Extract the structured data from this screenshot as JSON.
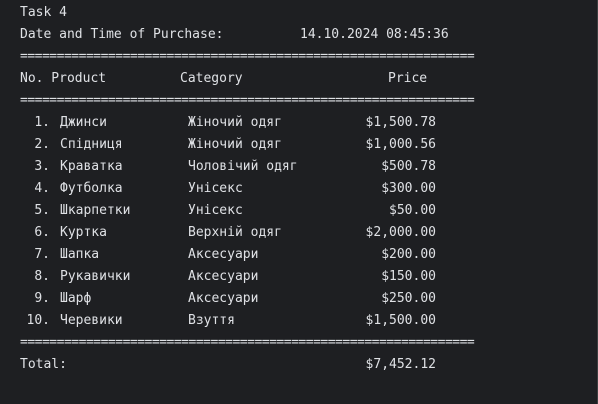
{
  "title": "Task 4",
  "purchase_label": "Date and Time of Purchase:",
  "purchase_datetime": "14.10.2024 08:45:36",
  "separator": "==============================================================",
  "headers": {
    "no_product": "No. Product",
    "category": "Category",
    "price": "Price"
  },
  "items": [
    {
      "num": "1.",
      "product": "Джинси",
      "category": "Жіночий одяг",
      "price": "$1,500.78"
    },
    {
      "num": "2.",
      "product": "Спідниця",
      "category": "Жіночий одяг",
      "price": "$1,000.56"
    },
    {
      "num": "3.",
      "product": "Краватка",
      "category": "Чоловічий одяг",
      "price": "$500.78"
    },
    {
      "num": "4.",
      "product": "Футболка",
      "category": "Унісекс",
      "price": "$300.00"
    },
    {
      "num": "5.",
      "product": "Шкарпетки",
      "category": "Унісекс",
      "price": "$50.00"
    },
    {
      "num": "6.",
      "product": "Куртка",
      "category": "Верхній одяг",
      "price": "$2,000.00"
    },
    {
      "num": "7.",
      "product": "Шапка",
      "category": "Аксесуари",
      "price": "$200.00"
    },
    {
      "num": "8.",
      "product": "Рукавички",
      "category": "Аксесуари",
      "price": "$150.00"
    },
    {
      "num": "9.",
      "product": "Шарф",
      "category": "Аксесуари",
      "price": "$250.00"
    },
    {
      "num": "10.",
      "product": "Черевики",
      "category": "Взуття",
      "price": "$1,500.00"
    }
  ],
  "total_label": "Total:",
  "total_value": "$7,452.12",
  "colors": {
    "background": "#1e1f22",
    "text": "#dfe1e5"
  }
}
